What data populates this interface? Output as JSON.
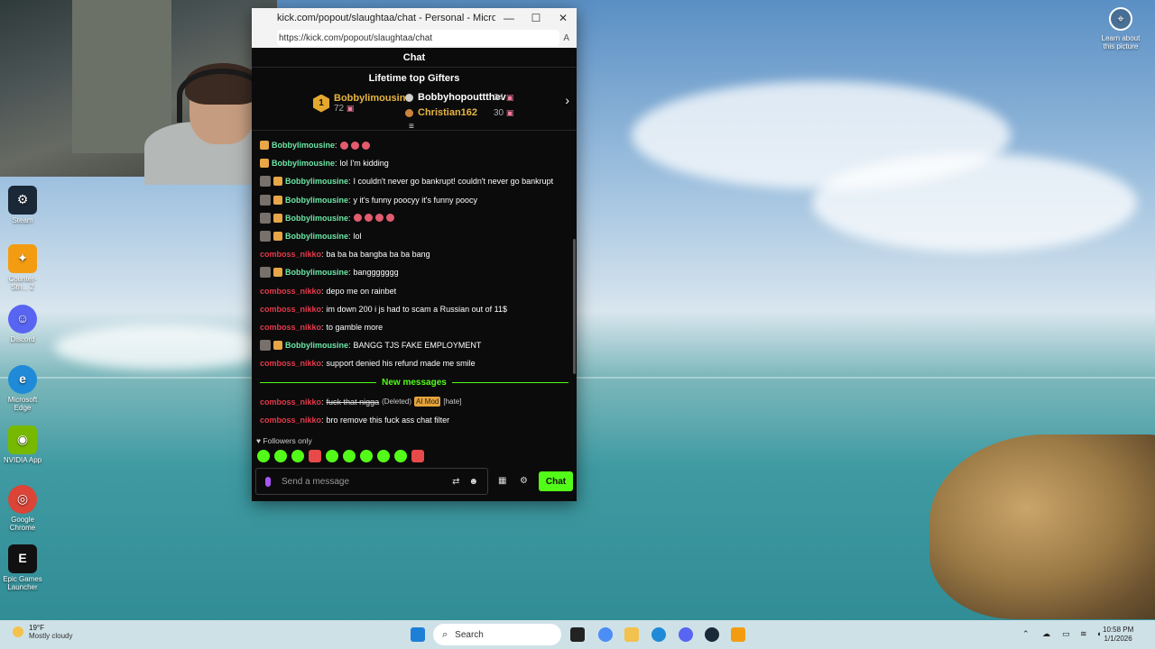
{
  "desktop": {
    "icons": [
      {
        "label": "Steam",
        "icon": "steam-icon",
        "color": "#1b2838"
      },
      {
        "label": "Counter-Stri... 2",
        "icon": "counter-strike-icon",
        "color": "#f39c12"
      },
      {
        "label": "Discord",
        "icon": "discord-icon",
        "color": "#5865f2"
      },
      {
        "label": "Microsoft Edge",
        "icon": "edge-icon",
        "color": "#1f8ad7"
      },
      {
        "label": "NVIDIA App",
        "icon": "nvidia-icon",
        "color": "#76b900"
      },
      {
        "label": "Google Chrome",
        "icon": "chrome-icon",
        "color": "#db4437"
      },
      {
        "label": "Epic Games Launcher",
        "icon": "epic-games-icon",
        "color": "#111111"
      }
    ],
    "learn_about": "Learn about this picture"
  },
  "browser": {
    "title": "kick.com/popout/slaughtaa/chat - Personal - Microsoft Edge",
    "url": "https://kick.com/popout/slaughtaa/chat"
  },
  "chat": {
    "header": "Chat",
    "gifters_title": "Lifetime top Gifters",
    "top_gifter": {
      "rank": "1",
      "name": "Bobbylimousine",
      "count": "72"
    },
    "gifters": [
      {
        "name": "Bobbyhopouttthev",
        "count": "34",
        "color": "#ffffff"
      },
      {
        "name": "Christian162",
        "count": "30",
        "color": "#e7b540"
      }
    ],
    "messages": [
      {
        "user": "Bobbylimousine",
        "text": "",
        "emotes": 3,
        "badges": [
          "gift"
        ]
      },
      {
        "user": "Bobbylimousine",
        "text": "lol I'm kidding",
        "emotes": 0,
        "badges": [
          "gift"
        ]
      },
      {
        "user": "Bobbylimousine",
        "text": "I couldn't never go bankrupt! couldn't never go bankrupt",
        "emotes": 0,
        "badges": [
          "avatar",
          "gift"
        ]
      },
      {
        "user": "Bobbylimousine",
        "text": "y it's funny poocyy it's funny poocy",
        "emotes": 0,
        "badges": [
          "avatar",
          "gift"
        ]
      },
      {
        "user": "Bobbylimousine",
        "text": "",
        "emotes": 4,
        "badges": [
          "avatar",
          "gift"
        ]
      },
      {
        "user": "Bobbylimousine",
        "text": "lol",
        "emotes": 0,
        "badges": [
          "avatar",
          "gift"
        ]
      },
      {
        "user": "comboss_nikko",
        "text": "ba ba ba bangba ba ba bang",
        "emotes": 0,
        "badges": []
      },
      {
        "user": "Bobbylimousine",
        "text": "banggggggg",
        "emotes": 0,
        "badges": [
          "avatar",
          "gift"
        ]
      },
      {
        "user": "comboss_nikko",
        "text": "depo me on rainbet",
        "emotes": 0,
        "badges": []
      },
      {
        "user": "comboss_nikko",
        "text": "im down 200 i js had to scam a Russian out of 11$",
        "emotes": 0,
        "badges": []
      },
      {
        "user": "comboss_nikko",
        "text": "to gamble more",
        "emotes": 0,
        "badges": []
      },
      {
        "user": "Bobbylimousine",
        "text": "BANGG TJS FAKE EMPLOYMENT",
        "emotes": 0,
        "badges": [
          "avatar",
          "gift"
        ]
      },
      {
        "user": "comboss_nikko",
        "text": "support denied his refund made me smile",
        "emotes": 0,
        "badges": []
      }
    ],
    "new_messages_label": "New messages",
    "deleted_message": {
      "user": "comboss_nikko",
      "text": "fuck that nigga",
      "deleted_tag": "(Deleted)",
      "mod_tag": "AI Mod",
      "reason": "[hate]"
    },
    "last_message": {
      "user": "comboss_nikko",
      "text": "bro remove this fuck ass chat filter"
    },
    "followers_only": "Followers only",
    "input_placeholder": "Send a message",
    "send_label": "Chat",
    "accent": "#53fc18"
  },
  "taskbar": {
    "temperature": "19°F",
    "weather": "Mostly cloudy",
    "search_placeholder": "Search",
    "time": "10:58 PM",
    "date": "1/1/2026"
  }
}
